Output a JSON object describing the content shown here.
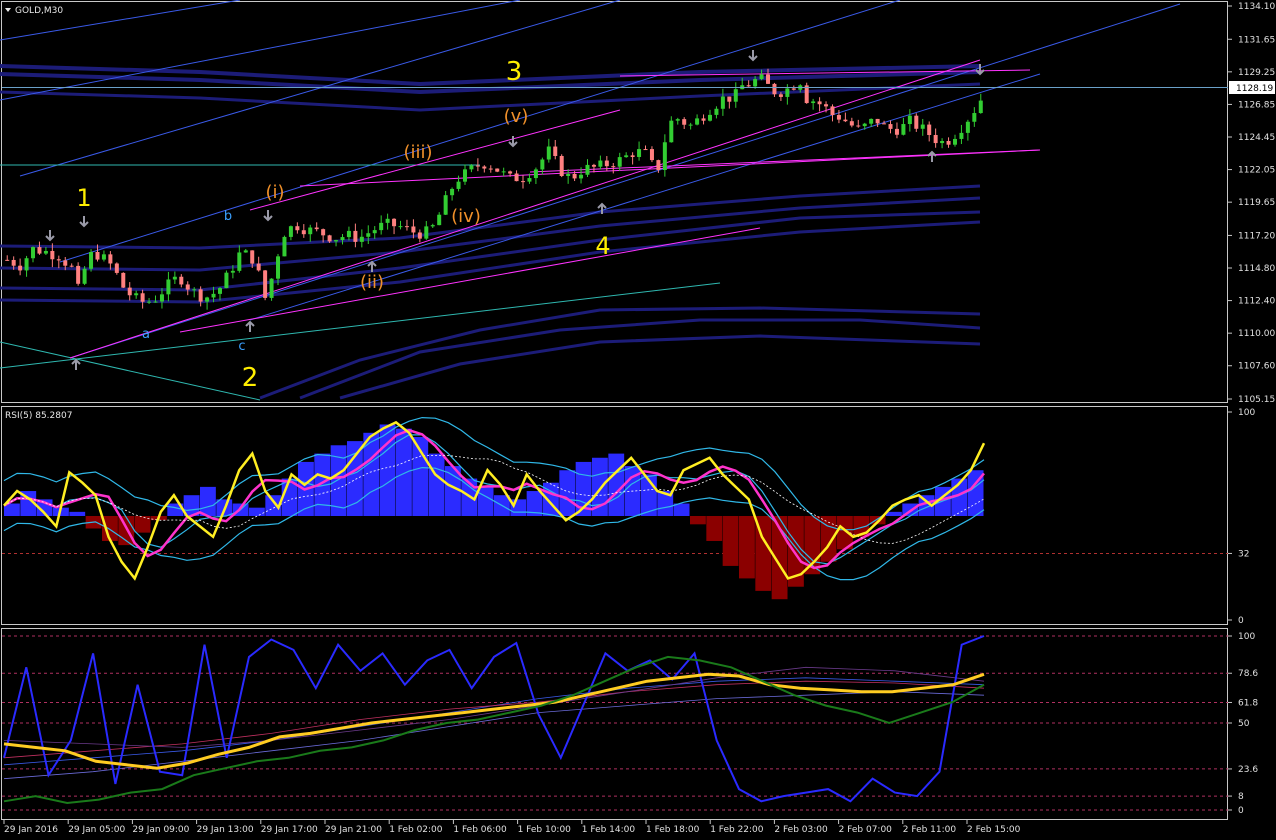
{
  "window": {
    "title": "GOLD,M30",
    "menu_icon": "triangle-down-icon"
  },
  "colors": {
    "background": "#000000",
    "grid": "#ffffff",
    "bull_candle": "#32cd32",
    "bear_candle": "#ff8080",
    "wave_major": "#ffee00",
    "wave_minor": "#f0902a",
    "wave_abc": "#3aa0ff",
    "channel_magenta": "#ff33ff",
    "channel_blue": "#3a5ae8",
    "ma_bands": "#1c1c78",
    "rsi_line": "#ffee22",
    "rsi_hist_pos": "#2b2bff",
    "rsi_hist_neg": "#8b0000",
    "stoch_fast": "#2a2aff",
    "stoch_signal": "#ffcc22",
    "stoch_slow": "#1a7a1a"
  },
  "chart_data": [
    {
      "type": "candlestick",
      "symbol": "GOLD",
      "timeframe": "M30",
      "title": "GOLD,M30",
      "ylim": [
        1105.15,
        1134.1
      ],
      "y_ticks": [
        "1134.10",
        "1131.65",
        "1129.25",
        "1126.85",
        "1124.45",
        "1122.05",
        "1119.65",
        "1117.20",
        "1114.80",
        "1112.40",
        "1110.00",
        "1107.60",
        "1105.15"
      ],
      "current_price": "1128.19",
      "x_labels": [
        "29 Jan 2016",
        "29 Jan 05:00",
        "29 Jan 09:00",
        "29 Jan 13:00",
        "29 Jan 17:00",
        "29 Jan 21:00",
        "1 Feb 02:00",
        "1 Feb 06:00",
        "1 Feb 10:00",
        "1 Feb 14:00",
        "1 Feb 18:00",
        "1 Feb 22:00",
        "2 Feb 03:00",
        "2 Feb 07:00",
        "2 Feb 11:00",
        "2 Feb 15:00"
      ],
      "close_path": [
        [
          0,
          1115.4
        ],
        [
          6,
          1115.0
        ],
        [
          12,
          1116.2
        ],
        [
          18,
          1116.0
        ],
        [
          24,
          1115.7
        ],
        [
          30,
          1114.8
        ],
        [
          33,
          1113.2
        ],
        [
          37,
          1115.2
        ],
        [
          40,
          1116.0
        ],
        [
          44,
          1115.6
        ],
        [
          49,
          1114.9
        ],
        [
          55,
          1113.1
        ],
        [
          62,
          1112.3
        ],
        [
          68,
          1112.4
        ],
        [
          74,
          1113.4
        ],
        [
          80,
          1114.2
        ],
        [
          86,
          1113.1
        ],
        [
          92,
          1112.6
        ],
        [
          98,
          1113.1
        ],
        [
          104,
          1114.6
        ],
        [
          108,
          1115.8
        ],
        [
          113,
          1115.8
        ],
        [
          116,
          1114.9
        ],
        [
          120,
          1112.6
        ],
        [
          124,
          1114.5
        ],
        [
          128,
          1117.3
        ],
        [
          134,
          1118.0
        ],
        [
          140,
          1117.6
        ],
        [
          146,
          1117.4
        ],
        [
          152,
          1117.0
        ],
        [
          158,
          1117.2
        ],
        [
          164,
          1117.0
        ],
        [
          170,
          1117.6
        ],
        [
          176,
          1118.0
        ],
        [
          182,
          1117.9
        ],
        [
          188,
          1117.5
        ],
        [
          194,
          1117.3
        ],
        [
          198,
          1117.8
        ],
        [
          202,
          1119.0
        ],
        [
          206,
          1120.5
        ],
        [
          210,
          1121.4
        ],
        [
          214,
          1121.8
        ],
        [
          218,
          1122.3
        ],
        [
          222,
          1122.5
        ],
        [
          226,
          1122.3
        ],
        [
          230,
          1121.8
        ],
        [
          234,
          1121.4
        ],
        [
          240,
          1121.5
        ],
        [
          246,
          1122.2
        ],
        [
          252,
          1123.4
        ],
        [
          256,
          1122.4
        ],
        [
          260,
          1121.5
        ],
        [
          264,
          1121.6
        ],
        [
          268,
          1122.1
        ],
        [
          274,
          1122.2
        ],
        [
          280,
          1122.5
        ],
        [
          286,
          1122.8
        ],
        [
          292,
          1123.4
        ],
        [
          298,
          1123.2
        ],
        [
          302,
          1121.6
        ],
        [
          306,
          1124.2
        ],
        [
          310,
          1126.0
        ],
        [
          314,
          1125.6
        ],
        [
          318,
          1125.3
        ],
        [
          322,
          1125.8
        ],
        [
          326,
          1126.4
        ],
        [
          330,
          1126.9
        ],
        [
          334,
          1127.4
        ],
        [
          338,
          1127.3
        ],
        [
          342,
          1128.2
        ],
        [
          346,
          1128.4
        ],
        [
          350,
          1128.8
        ],
        [
          354,
          1128.2
        ],
        [
          358,
          1127.7
        ],
        [
          362,
          1127.9
        ],
        [
          366,
          1128.3
        ],
        [
          368,
          1129.0
        ],
        [
          372,
          1127.3
        ],
        [
          376,
          1127.1
        ],
        [
          380,
          1126.7
        ],
        [
          384,
          1126.1
        ],
        [
          388,
          1125.9
        ],
        [
          392,
          1125.4
        ],
        [
          396,
          1125.0
        ],
        [
          400,
          1125.3
        ],
        [
          404,
          1125.8
        ],
        [
          408,
          1125.2
        ],
        [
          412,
          1125.0
        ],
        [
          416,
          1125.1
        ],
        [
          420,
          1125.6
        ],
        [
          424,
          1125.2
        ],
        [
          428,
          1124.8
        ],
        [
          432,
          1124.3
        ],
        [
          436,
          1124.0
        ],
        [
          440,
          1124.5
        ],
        [
          444,
          1125.2
        ],
        [
          448,
          1126.0
        ],
        [
          452,
          1126.9
        ],
        [
          456,
          1128.2
        ]
      ],
      "wave_labels": [
        "1",
        "2",
        "3",
        "4",
        "(i)",
        "(ii)",
        "(iii)",
        "(iv)",
        "(v)",
        "a",
        "b",
        "c"
      ]
    },
    {
      "type": "line",
      "title": "RSI(5) 85.2807",
      "ylim": [
        0,
        100
      ],
      "y_ticks": [
        "100",
        "32",
        "0"
      ],
      "series": [
        {
          "name": "RSI(5)",
          "values": [
            55,
            62,
            58,
            52,
            45,
            71,
            66,
            60,
            40,
            28,
            20,
            35,
            52,
            60,
            50,
            45,
            40,
            55,
            72,
            80,
            62,
            54,
            70,
            65,
            70,
            68,
            72,
            80,
            88,
            92,
            95,
            90,
            80,
            70,
            65,
            62,
            58,
            72,
            65,
            55,
            70,
            62,
            55,
            48,
            52,
            58,
            66,
            72,
            78,
            70,
            62,
            60,
            72,
            75,
            78,
            70,
            64,
            58,
            40,
            30,
            20,
            22,
            28,
            35,
            45,
            40,
            42,
            48,
            55,
            58,
            60,
            55,
            60,
            65,
            72,
            85
          ]
        }
      ],
      "histogram": [
        6,
        12,
        8,
        4,
        2,
        -6,
        -12,
        -14,
        -8,
        -2,
        6,
        10,
        14,
        8,
        6,
        4,
        10,
        18,
        26,
        30,
        34,
        36,
        40,
        44,
        42,
        38,
        30,
        24,
        18,
        14,
        10,
        8,
        12,
        16,
        22,
        26,
        28,
        30,
        24,
        20,
        12,
        6,
        -4,
        -12,
        -24,
        -30,
        -36,
        -40,
        -34,
        -28,
        -22,
        -16,
        -10,
        -4,
        2,
        6,
        10,
        14,
        18,
        22
      ]
    },
    {
      "type": "line",
      "title": "",
      "ylim": [
        0,
        100
      ],
      "y_ticks": [
        "100",
        "78.6",
        "61.8",
        "50",
        "23.6",
        "8",
        "0"
      ],
      "series": [
        {
          "name": "",
          "values": [
            30,
            82,
            20,
            40,
            90,
            15,
            72,
            22,
            20,
            95,
            30,
            88,
            98,
            92,
            70,
            95,
            80,
            90,
            72,
            86,
            92,
            70,
            88,
            96,
            55,
            30,
            60,
            90,
            80,
            86,
            75,
            90,
            40,
            12,
            5,
            8,
            10,
            12,
            5,
            18,
            10,
            8,
            22,
            95,
            100
          ]
        },
        {
          "name": "",
          "values": [
            38,
            36,
            34,
            28,
            26,
            24,
            27,
            32,
            36,
            42,
            44,
            47,
            50,
            52,
            54,
            56,
            58,
            60,
            62,
            66,
            70,
            74,
            76,
            78,
            77,
            72,
            70,
            69,
            68,
            68,
            70,
            72,
            78
          ]
        },
        {
          "name": "",
          "values": [
            5,
            8,
            4,
            6,
            10,
            12,
            20,
            24,
            28,
            30,
            34,
            36,
            40,
            46,
            50,
            52,
            56,
            60,
            66,
            74,
            82,
            88,
            86,
            82,
            74,
            66,
            60,
            56,
            50,
            56,
            62,
            72
          ]
        }
      ]
    }
  ]
}
